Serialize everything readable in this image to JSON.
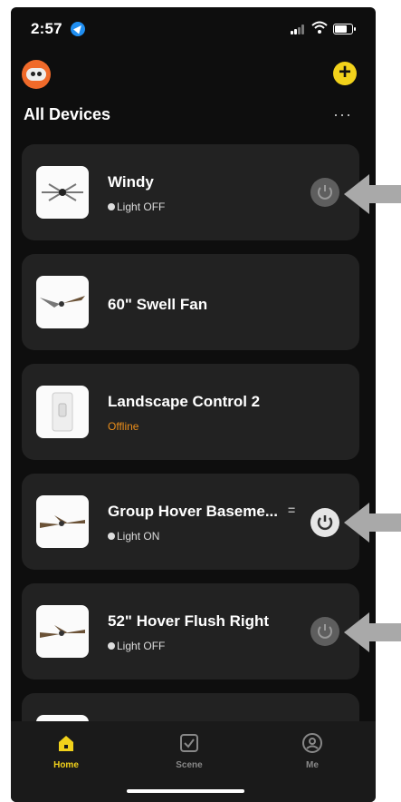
{
  "status_bar": {
    "time": "2:57"
  },
  "header": {
    "title": "All Devices",
    "more_label": "···",
    "add_label": "+"
  },
  "devices": [
    {
      "name": "Windy",
      "status": "Light OFF",
      "state": "off"
    },
    {
      "name": "60\" Swell Fan",
      "status": "",
      "state": "none"
    },
    {
      "name": "Landscape Control 2",
      "status": "Offline",
      "state": "offline"
    },
    {
      "name": "Group Hover Baseme...",
      "status": "Light ON",
      "state": "on"
    },
    {
      "name": "52\" Hover Flush Right",
      "status": "Light OFF",
      "state": "off"
    }
  ],
  "tabs": [
    {
      "label": "Home",
      "active": true
    },
    {
      "label": "Scene",
      "active": false
    },
    {
      "label": "Me",
      "active": false
    }
  ],
  "colors": {
    "accent": "#f2d21b",
    "offline": "#e98d1a",
    "card": "#222222",
    "background": "#0e0e0e"
  }
}
